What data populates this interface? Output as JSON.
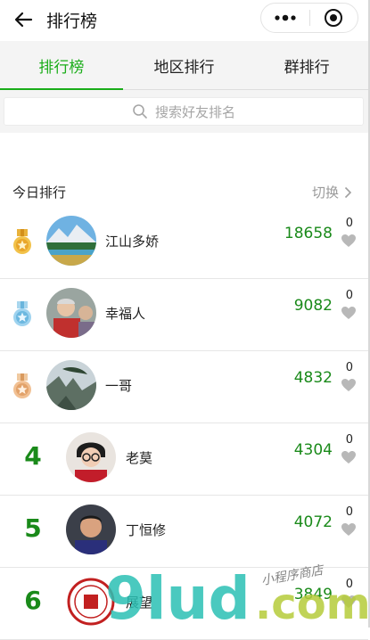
{
  "nav": {
    "title": "排行榜",
    "back_icon": "arrow-left-icon",
    "more_icon": "more-dots-icon",
    "close_icon": "target-close-icon"
  },
  "tabs": [
    {
      "label": "排行榜",
      "active": true
    },
    {
      "label": "地区排行",
      "active": false
    },
    {
      "label": "群排行",
      "active": false
    }
  ],
  "search": {
    "placeholder": "搜索好友排名",
    "icon": "search-icon"
  },
  "section": {
    "title": "今日排行",
    "switch_label": "切换",
    "switch_icon": "chevron-right-icon"
  },
  "rows": [
    {
      "rank": "1",
      "rank_icon": "gold-medal-icon",
      "name": "江山多娇",
      "score": "18658",
      "likes": "0"
    },
    {
      "rank": "2",
      "rank_icon": "silver-medal-icon",
      "name": "幸福人",
      "score": "9082",
      "likes": "0"
    },
    {
      "rank": "3",
      "rank_icon": "bronze-medal-icon",
      "name": "一哥",
      "score": "4832",
      "likes": "0"
    },
    {
      "rank": "4",
      "name": "老莫",
      "score": "4304",
      "likes": "0"
    },
    {
      "rank": "5",
      "name": "丁恒修",
      "score": "4072",
      "likes": "0"
    },
    {
      "rank": "6",
      "name": "展望",
      "score": "3849",
      "likes": "0"
    }
  ],
  "watermark": {
    "text": "9lud.com",
    "script_text": "小程序商店"
  },
  "colors": {
    "accent": "#1aad19",
    "score": "#1a8a1a",
    "gold": "#e9b23a",
    "silver": "#7ec3e6",
    "bronze": "#e2a970"
  }
}
